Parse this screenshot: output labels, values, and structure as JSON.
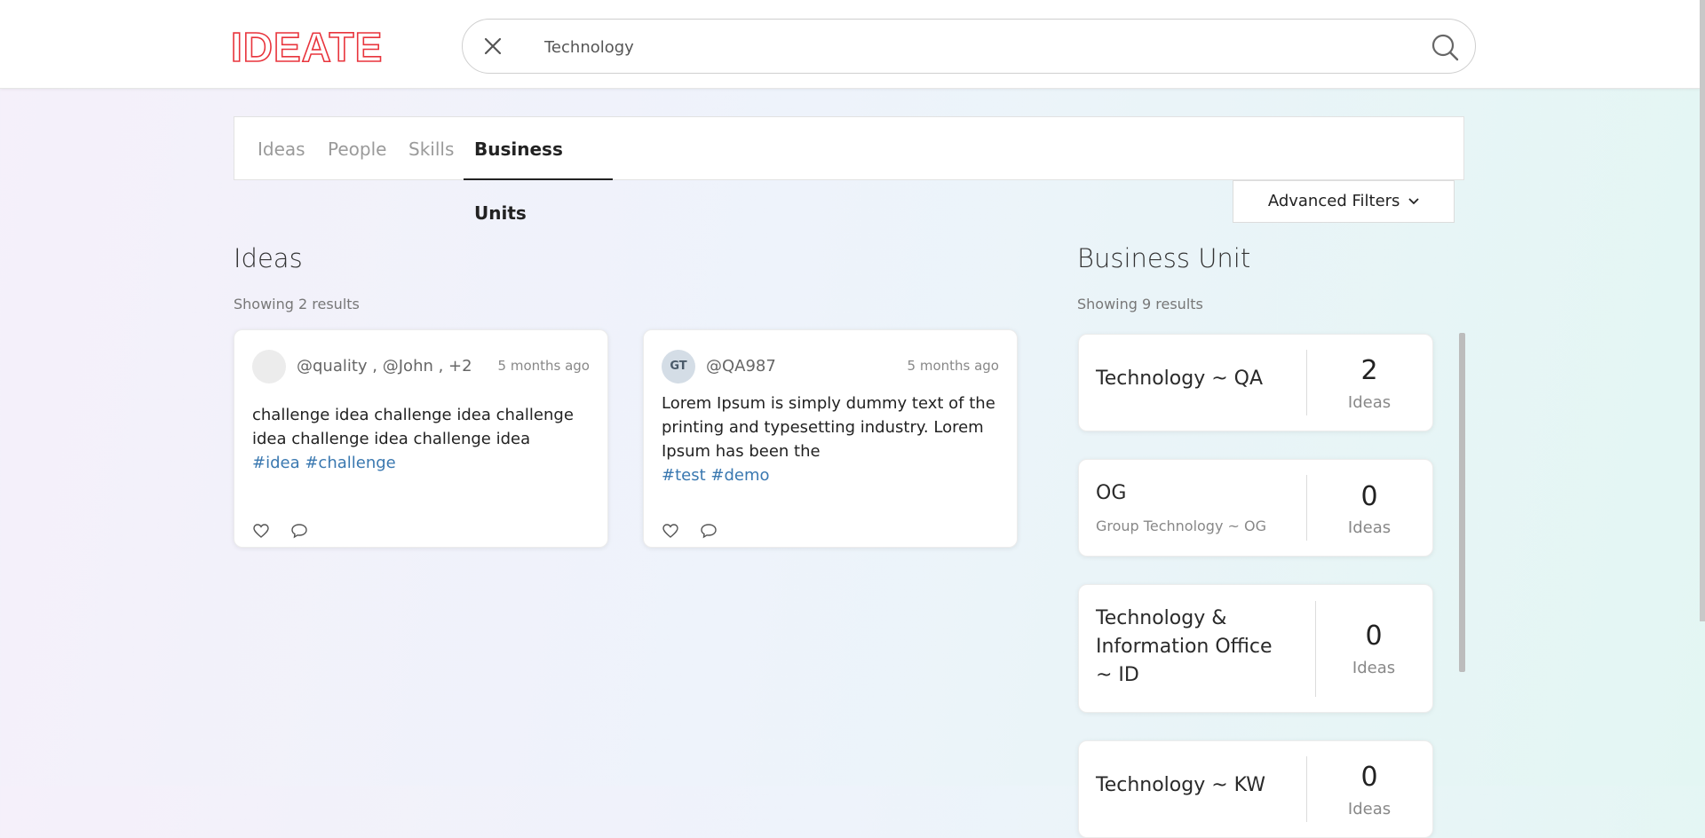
{
  "header": {
    "logo": "IDEATE",
    "search": {
      "value": "Technology",
      "placeholder": "Technology"
    }
  },
  "tabs": [
    {
      "label": "Ideas"
    },
    {
      "label": "People"
    },
    {
      "label": "Skills"
    },
    {
      "label": "Business Units"
    }
  ],
  "active_tab": "Business Units",
  "filters": {
    "advanced_label": "Advanced Filters"
  },
  "ideas": {
    "title": "Ideas",
    "count_text": "Showing 2 results",
    "cards": [
      {
        "avatar": "",
        "handle": "@quality , @John , +2",
        "time": "5 months ago",
        "text": "challenge idea challenge idea challenge idea challenge idea challenge idea",
        "tags": "#idea #challenge"
      },
      {
        "avatar": "GT",
        "handle": "@QA987",
        "time": "5 months ago",
        "text": "Lorem Ipsum is simply dummy text of the printing and typesetting industry. Lorem Ipsum has been the",
        "tags": "#test #demo"
      }
    ]
  },
  "business_units": {
    "title": "Business Unit",
    "count_text": "Showing 9 results",
    "items": [
      {
        "name": "Technology ~ QA",
        "sub": "",
        "count": "2",
        "label": "Ideas"
      },
      {
        "name": "OG",
        "sub": "Group Technology ~ OG",
        "count": "0",
        "label": "Ideas"
      },
      {
        "name": "Technology & Information Office ~ ID",
        "sub": "",
        "count": "0",
        "label": "Ideas"
      },
      {
        "name": "Technology ~ KW",
        "sub": "",
        "count": "0",
        "label": "Ideas"
      }
    ]
  },
  "colors": {
    "brand": "#e8343c",
    "tag": "#3a78b0"
  }
}
